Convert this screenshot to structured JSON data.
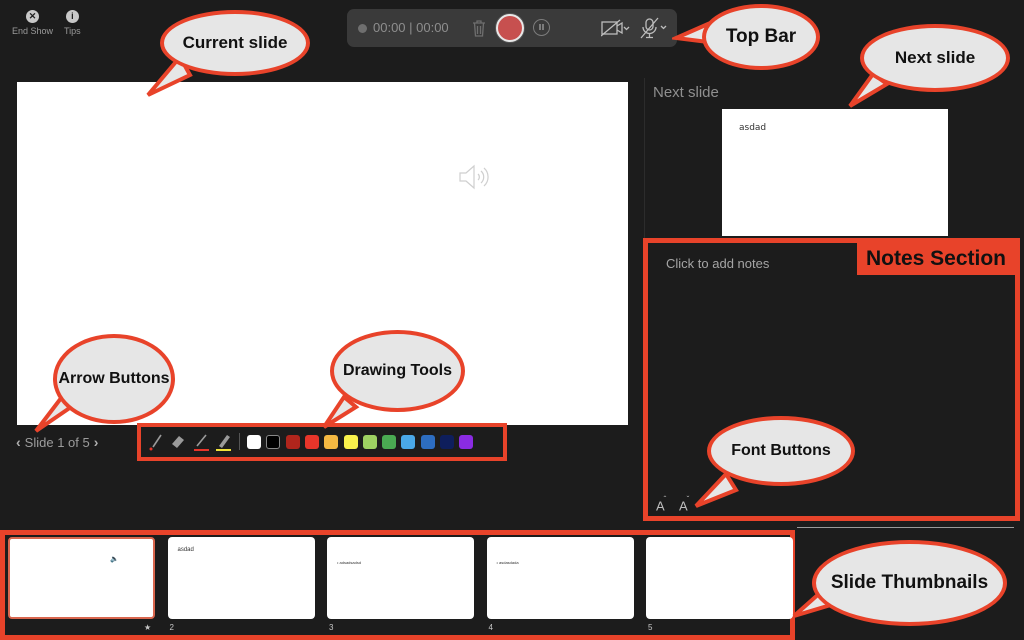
{
  "top_left": {
    "end_show": {
      "icon": "close-icon",
      "label": "End Show"
    },
    "tips": {
      "icon": "info-icon",
      "label": "Tips"
    }
  },
  "top_bar": {
    "timer": "00:00 | 00:00",
    "status_dot": "recording-status-dot",
    "buttons": [
      "trash-icon",
      "record-button",
      "pause-button",
      "camera-off-toggle",
      "mic-off-toggle"
    ]
  },
  "current_slide": {
    "media_icon": "speaker-icon"
  },
  "slide_nav": {
    "prev": "‹",
    "label": "Slide 1 of 5",
    "next": "›"
  },
  "drawing_tools": {
    "tools": [
      "laser-pointer",
      "eraser",
      "pen-red",
      "highlighter-yellow"
    ],
    "colors": [
      "#ffffff",
      "#000000",
      "#b0251c",
      "#e8352a",
      "#f4b942",
      "#f9f24c",
      "#9ed162",
      "#4aaa52",
      "#4aa8e8",
      "#2d6dc0",
      "#0e1e5c",
      "#8a2be2"
    ]
  },
  "next_slide": {
    "label": "Next slide",
    "content": "asdad"
  },
  "notes": {
    "placeholder": "Click to add notes",
    "font_increase": "A",
    "font_decrease": "A"
  },
  "thumbnails": [
    {
      "number": "★",
      "title": "",
      "bullet": "",
      "selected": true
    },
    {
      "number": "2",
      "title": "asdad",
      "bullet": "",
      "selected": false
    },
    {
      "number": "3",
      "title": "",
      "bullet": "• adsadsadsd",
      "selected": false
    },
    {
      "number": "4",
      "title": "",
      "bullet": "• asdasdada",
      "selected": false
    },
    {
      "number": "5",
      "title": "",
      "bullet": "",
      "selected": false
    }
  ],
  "annotations": {
    "current_slide": "Current slide",
    "top_bar": "Top Bar",
    "next_slide": "Next slide",
    "notes_section": "Notes Section",
    "arrow_buttons": "Arrow Buttons",
    "drawing_tools": "Drawing Tools",
    "font_buttons": "Font Buttons",
    "slide_thumbnails": "Slide Thumbnails"
  }
}
